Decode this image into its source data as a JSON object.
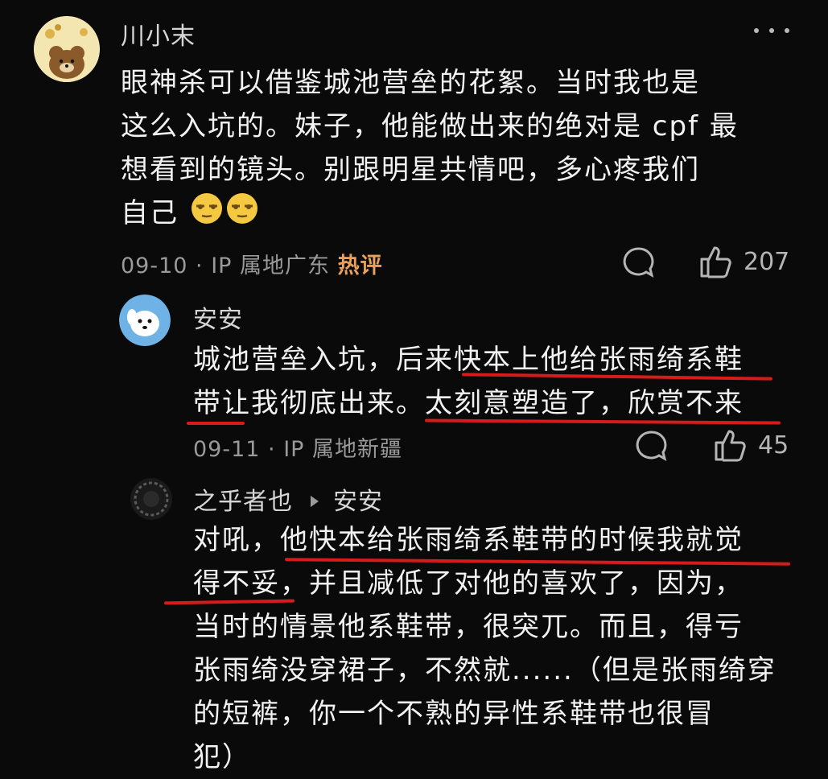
{
  "comments": [
    {
      "username": "川小末",
      "lines": [
        "眼神杀可以借鉴城池营垒的花絮。当时我也是",
        "这么入坑的。妹子，他能做出来的绝对是 cpf 最",
        "想看到的镜头。别跟明星共情吧，多心疼我们",
        "自己"
      ],
      "date": "09-10",
      "location": "IP 属地广东",
      "tag": "热评",
      "likes": "207",
      "avatar_icon": "bear-avatar-icon",
      "emoji_icon": "smirk-emoji-icon"
    },
    {
      "username": "安安",
      "lines": [
        "城池营垒入坑，后来快本上他给张雨绮系鞋",
        "带让我彻底出来。太刻意塑造了，欣赏不来"
      ],
      "date": "09-11",
      "location": "IP 属地新疆",
      "likes": "45",
      "avatar_icon": "dog-avatar-icon"
    },
    {
      "username": "之乎者也",
      "reply_to": "安安",
      "lines": [
        "对吼，他快本给张雨绮系鞋带的时候我就觉",
        "得不妥，并且减低了对他的喜欢了，因为，",
        "当时的情景他系鞋带，很突兀。而且，得亏",
        "张雨绮没穿裙子，不然就......（但是张雨绮穿",
        "的短裤，你一个不熟的异性系鞋带也很冒",
        "犯）"
      ],
      "avatar_icon": "dark-avatar-icon"
    }
  ],
  "colors": {
    "background": "#0a0a0a",
    "highlight": "#d61b1b",
    "hot_tag": "#e8a15a"
  }
}
